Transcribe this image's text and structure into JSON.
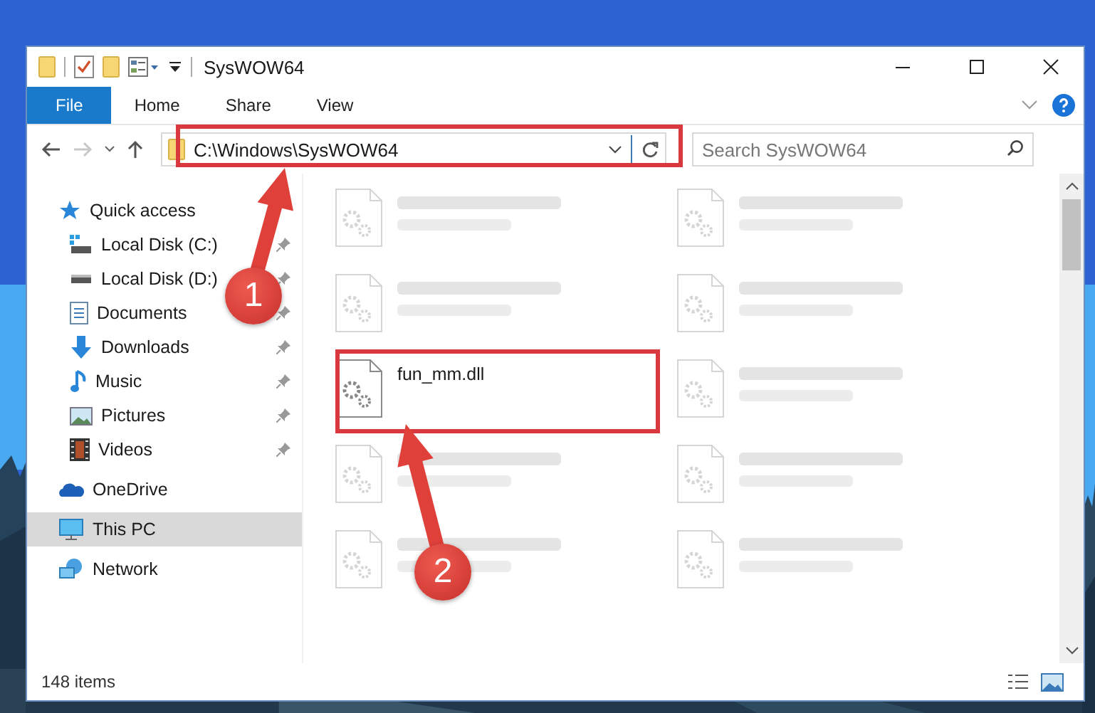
{
  "window": {
    "title": "SysWOW64"
  },
  "ribbon": {
    "tabs": [
      {
        "label": "File",
        "selected": true
      },
      {
        "label": "Home",
        "selected": false
      },
      {
        "label": "Share",
        "selected": false
      },
      {
        "label": "View",
        "selected": false
      }
    ]
  },
  "address_bar": {
    "path": "C:\\Windows\\SysWOW64"
  },
  "search": {
    "placeholder": "Search SysWOW64"
  },
  "navigation": [
    {
      "label": "Quick access",
      "kind": "star",
      "selected": false,
      "children": [
        {
          "label": "Local Disk (C:)",
          "kind": "system-drive",
          "pinned": true,
          "selected": false
        },
        {
          "label": "Local Disk (D:)",
          "kind": "drive",
          "pinned": true,
          "selected": false
        },
        {
          "label": "Documents",
          "kind": "documents",
          "pinned": true,
          "selected": false
        },
        {
          "label": "Downloads",
          "kind": "downloads",
          "pinned": true,
          "selected": false
        },
        {
          "label": "Music",
          "kind": "music",
          "pinned": true,
          "selected": false
        },
        {
          "label": "Pictures",
          "kind": "pictures",
          "pinned": true,
          "selected": false
        },
        {
          "label": "Videos",
          "kind": "videos",
          "pinned": true,
          "selected": false
        }
      ]
    },
    {
      "label": "OneDrive",
      "kind": "cloud",
      "selected": false
    },
    {
      "label": "This PC",
      "kind": "computer",
      "selected": true
    },
    {
      "label": "Network",
      "kind": "network",
      "selected": false
    }
  ],
  "files": [
    {
      "blurred": true
    },
    {
      "blurred": true
    },
    {
      "blurred": true
    },
    {
      "blurred": true
    },
    {
      "name": "fun_mm.dll",
      "blurred": false
    },
    {
      "blurred": true
    },
    {
      "blurred": true
    },
    {
      "blurred": true
    },
    {
      "blurred": true
    },
    {
      "blurred": true
    }
  ],
  "status_bar": {
    "item_count": "148 items"
  },
  "annotations": {
    "badges": [
      {
        "number": "1"
      },
      {
        "number": "2"
      }
    ]
  }
}
